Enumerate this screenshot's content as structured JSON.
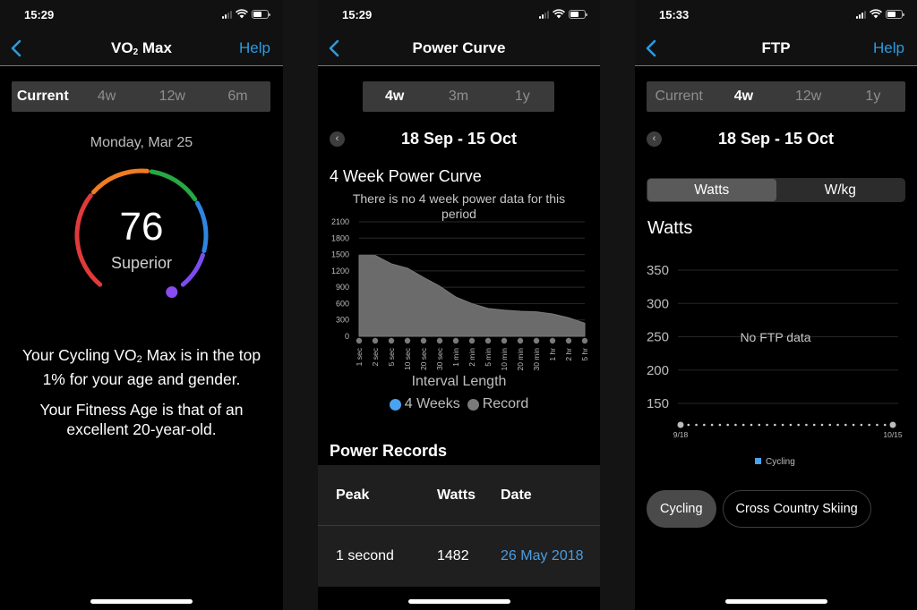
{
  "screens": [
    {
      "status": {
        "time": "15:29"
      },
      "nav": {
        "title_pre": "VO",
        "title_sub": "2",
        "title_post": " Max",
        "help": "Help"
      },
      "ranges": [
        {
          "label": "Current",
          "active": true
        },
        {
          "label": "4w",
          "active": false
        },
        {
          "label": "12w",
          "active": false
        },
        {
          "label": "6m",
          "active": false
        }
      ],
      "date": "Monday, Mar 25",
      "gauge": {
        "value": "76",
        "category": "Superior",
        "segment_colors": [
          "#e03a3a",
          "#f07d22",
          "#27a845",
          "#2f85e0",
          "#7c4cf0"
        ],
        "marker_color": "#8a4cf0"
      },
      "message1": {
        "pre": "Your Cycling VO",
        "sub": "2",
        "post": " Max is in the top 1% for your age and gender."
      },
      "message2": "Your Fitness Age is that of an excellent 20-year-old."
    },
    {
      "status": {
        "time": "15:29"
      },
      "nav": {
        "title": "Power Curve"
      },
      "ranges": [
        {
          "label": "4w",
          "active": true
        },
        {
          "label": "3m",
          "active": false
        },
        {
          "label": "1y",
          "active": false
        }
      ],
      "date_range": "18 Sep - 15 Oct",
      "chart_title": "4 Week Power Curve",
      "no_data_text": "There is no 4 week power data for this period",
      "x_axis_label": "Interval Length",
      "legend": [
        {
          "label": "4 Weeks",
          "color": "#4aa3f0"
        },
        {
          "label": "Record",
          "color": "#7a7a7a"
        }
      ],
      "records_title": "Power Records",
      "records_table": {
        "headers": [
          "Peak",
          "Watts",
          "Date"
        ],
        "rows": [
          {
            "peak": "1 second",
            "watts": "1482",
            "date": "26 May 2018"
          }
        ]
      }
    },
    {
      "status": {
        "time": "15:33"
      },
      "nav": {
        "title": "FTP",
        "help": "Help"
      },
      "ranges": [
        {
          "label": "Current",
          "active": false
        },
        {
          "label": "4w",
          "active": true
        },
        {
          "label": "12w",
          "active": false
        },
        {
          "label": "1y",
          "active": false
        }
      ],
      "date_range": "18 Sep - 15 Oct",
      "unit_toggle": [
        {
          "label": "Watts",
          "active": true
        },
        {
          "label": "W/kg",
          "active": false
        }
      ],
      "chart_title": "Watts",
      "no_data_text": "No FTP data",
      "legend": {
        "label": "Cycling",
        "color": "#4aa3f0"
      },
      "sports": [
        {
          "label": "Cycling",
          "active": true
        },
        {
          "label": "Cross Country Skiing",
          "active": false
        }
      ]
    }
  ],
  "chart_data": [
    {
      "type": "area",
      "title": "4 Week Power Curve",
      "xlabel": "Interval Length",
      "ylabel": "",
      "categories": [
        "1 sec",
        "2 sec",
        "5 sec",
        "10 sec",
        "20 sec",
        "30 sec",
        "1 min",
        "2 min",
        "5 min",
        "10 min",
        "20 min",
        "30 min",
        "1 hr",
        "2 hr",
        "5 hr"
      ],
      "series": [
        {
          "name": "Record",
          "color": "#6b6b6b",
          "values": [
            1482,
            1482,
            1330,
            1250,
            1080,
            920,
            720,
            600,
            510,
            480,
            460,
            450,
            410,
            340,
            240
          ]
        },
        {
          "name": "4 Weeks",
          "color": "#4aa3f0",
          "values": []
        }
      ],
      "yticks": [
        0,
        300,
        600,
        900,
        1200,
        1500,
        1800,
        2100
      ],
      "ylim": [
        0,
        2100
      ],
      "grid": true,
      "legend": "bottom"
    },
    {
      "type": "line",
      "title": "Watts",
      "series": [
        {
          "name": "Cycling",
          "color": "#4aa3f0",
          "values": []
        }
      ],
      "x_start": "9/18",
      "x_end": "10/15",
      "x_days": 28,
      "yticks": [
        150,
        200,
        250,
        300,
        350
      ],
      "ylim": [
        125,
        360
      ],
      "grid": true,
      "legend": "bottom"
    }
  ]
}
